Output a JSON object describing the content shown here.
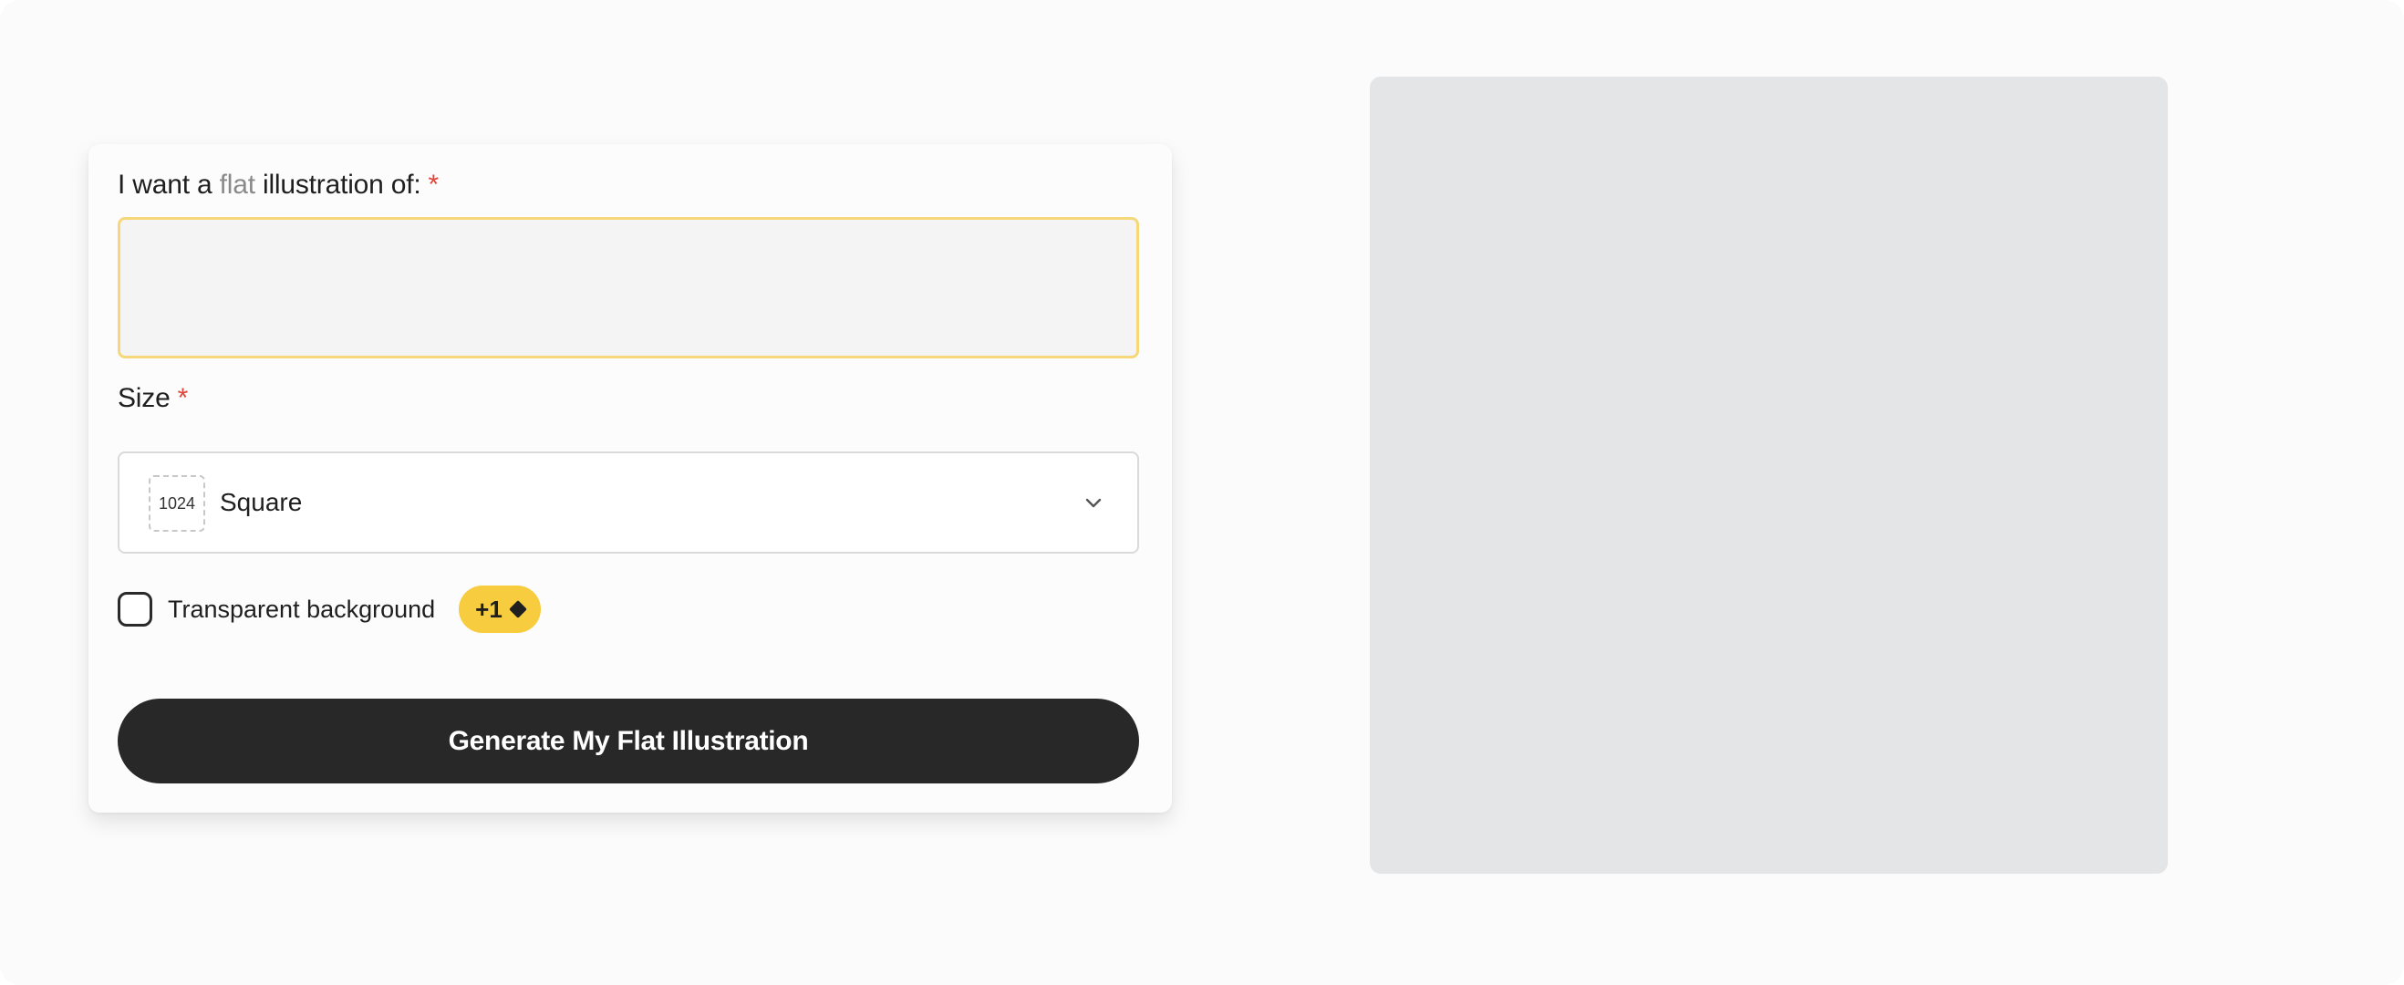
{
  "form": {
    "prompt_label_prefix": "I want a",
    "prompt_label_accent": "flat",
    "prompt_label_suffix": "illustration of:",
    "required_marker": "*",
    "prompt_value": "",
    "size_label": "Size",
    "size_badge": "1024",
    "size_value": "Square",
    "transparent_label": "Transparent background",
    "transparent_checked": false,
    "cost_badge": "+1",
    "generate_label": "Generate My Flat Illustration"
  },
  "colors": {
    "input_border_focus": "#f6d77a",
    "required": "#e0453b",
    "cost_badge_bg": "#f7cc3f",
    "button_bg": "#282828",
    "preview_bg": "#e3e5e7"
  },
  "icons": {
    "select_chevron": "chevron-down-icon",
    "cost_icon": "diamond-icon"
  }
}
